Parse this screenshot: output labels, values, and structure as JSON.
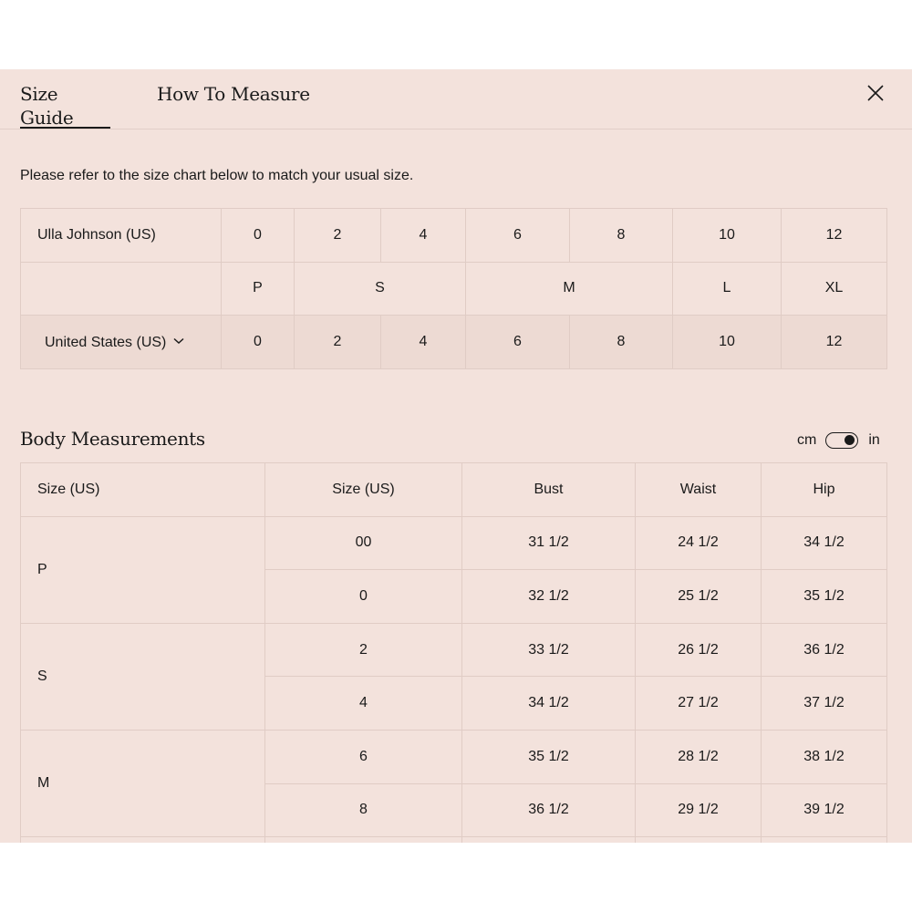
{
  "tabs": [
    {
      "label": "Size Guide",
      "active": true
    },
    {
      "label": "How To Measure",
      "active": false
    }
  ],
  "intro": "Please refer to the size chart below to match your usual size.",
  "size_table": {
    "brand_label": "Ulla Johnson (US)",
    "brand_sizes": [
      "0",
      "2",
      "4",
      "6",
      "8",
      "10",
      "12"
    ],
    "letter_sizes": [
      "P",
      "S",
      "M",
      "L",
      "XL"
    ],
    "country_label": "United States (US)",
    "country_sizes": [
      "0",
      "2",
      "4",
      "6",
      "8",
      "10",
      "12"
    ]
  },
  "body": {
    "title": "Body Measurements",
    "unit_left": "cm",
    "unit_right": "in",
    "selected_unit": "in",
    "headers": [
      "Size (US)",
      "Size (US)",
      "Bust",
      "Waist",
      "Hip"
    ],
    "groups": [
      {
        "label": "P",
        "rows": [
          {
            "size": "00",
            "bust": "31 1/2",
            "waist": "24 1/2",
            "hip": "34 1/2"
          },
          {
            "size": "0",
            "bust": "32 1/2",
            "waist": "25 1/2",
            "hip": "35 1/2"
          }
        ]
      },
      {
        "label": "S",
        "rows": [
          {
            "size": "2",
            "bust": "33 1/2",
            "waist": "26 1/2",
            "hip": "36 1/2"
          },
          {
            "size": "4",
            "bust": "34 1/2",
            "waist": "27 1/2",
            "hip": "37 1/2"
          }
        ]
      },
      {
        "label": "M",
        "rows": [
          {
            "size": "6",
            "bust": "35 1/2",
            "waist": "28 1/2",
            "hip": "38 1/2"
          },
          {
            "size": "8",
            "bust": "36 1/2",
            "waist": "29 1/2",
            "hip": "39 1/2"
          }
        ]
      }
    ]
  }
}
